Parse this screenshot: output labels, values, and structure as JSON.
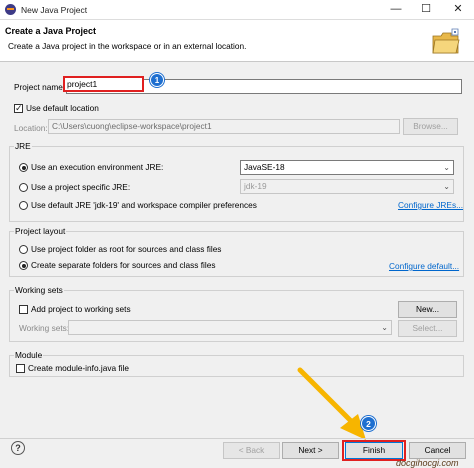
{
  "window": {
    "title": "New Java Project",
    "controls": {
      "minimize": "—",
      "maximize": "☐",
      "close": "✕"
    }
  },
  "header": {
    "title": "Create a Java Project",
    "subtitle": "Create a Java project in the workspace or in an external location."
  },
  "project": {
    "name_label": "Project name:",
    "name_value": "project1",
    "use_default_location_label": "Use default location",
    "use_default_location_checked": true,
    "location_label": "Location:",
    "location_value": "C:\\Users\\cuong\\eclipse-workspace\\project1",
    "browse_label": "Browse..."
  },
  "jre": {
    "group_label": "JRE",
    "option1_label": "Use an execution environment JRE:",
    "option1_value": "JavaSE-18",
    "option2_label": "Use a project specific JRE:",
    "option2_value": "jdk-19",
    "option3_label": "Use default JRE 'jdk-19' and workspace compiler preferences",
    "configure_link": "Configure JREs...",
    "selected": "option1"
  },
  "layout": {
    "group_label": "Project layout",
    "option1_label": "Use project folder as root for sources and class files",
    "option2_label": "Create separate folders for sources and class files",
    "configure_link": "Configure default...",
    "selected": "option2"
  },
  "working_sets": {
    "group_label": "Working sets",
    "add_label": "Add project to working sets",
    "new_label": "New...",
    "sets_label": "Working sets:",
    "select_label": "Select..."
  },
  "module": {
    "group_label": "Module",
    "create_label": "Create module-info.java file"
  },
  "footer": {
    "help_icon": "?",
    "back_label": "< Back",
    "next_label": "Next >",
    "finish_label": "Finish",
    "cancel_label": "Cancel"
  },
  "annotations": {
    "badge1": "1",
    "badge2": "2",
    "highlight_color": "#e02020",
    "arrow_color": "#f7b500",
    "badge_color": "#1e6fd0"
  },
  "watermark": "docgihocgi.com"
}
